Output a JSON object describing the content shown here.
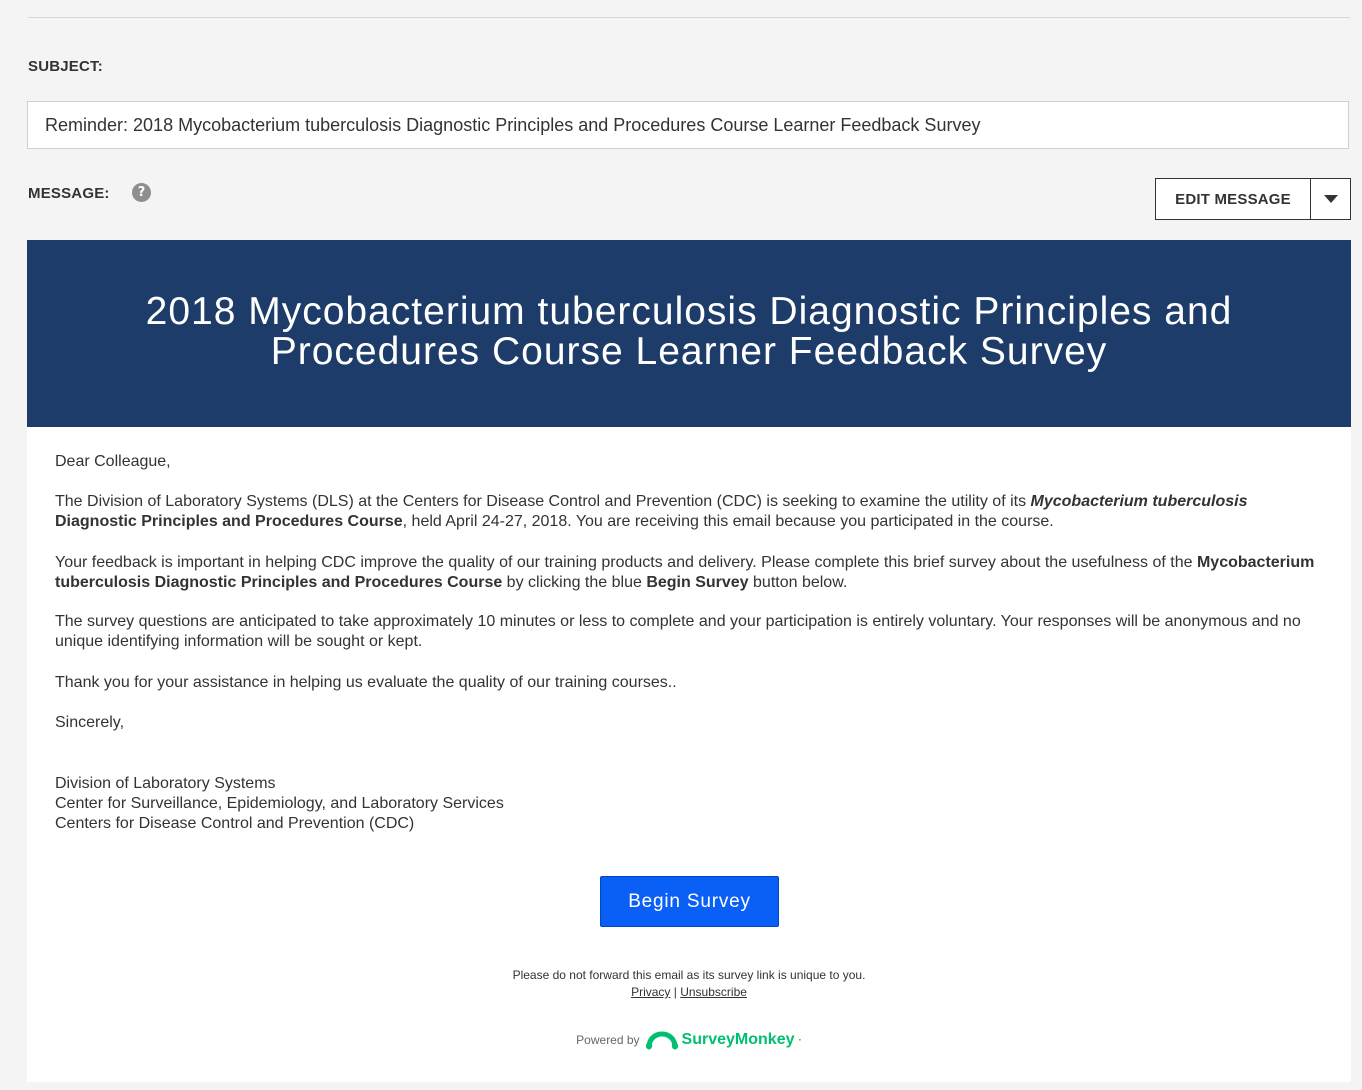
{
  "subject": {
    "label": "SUBJECT:",
    "value": "Reminder: 2018 Mycobacterium tuberculosis Diagnostic Principles and Procedures Course Learner Feedback Survey"
  },
  "message": {
    "label": "MESSAGE:",
    "help_icon": "?",
    "edit_label": "EDIT MESSAGE"
  },
  "email": {
    "banner_title_line1": "2018 Mycobacterium tuberculosis Diagnostic Principles and",
    "banner_title_line2": "Procedures Course Learner Feedback Survey",
    "greeting": "Dear Colleague,",
    "p1": {
      "a": "The Division of Laboratory Systems (DLS) at the Centers for Disease Control and Prevention (CDC) is seeking to examine the utility of its ",
      "b_italic": "Mycobacterium tuberculosis",
      "c_bold": " Diagnostic Principles and Procedures Course",
      "d": ", held April 24-27, 2018.  You are receiving this email because you participated in the course."
    },
    "p2": {
      "a": "Your feedback is important in helping CDC improve the quality of our training products and delivery. Please complete this brief survey about the usefulness of the ",
      "b_bold": "Mycobacterium tuberculosis Diagnostic Principles and Procedures Course",
      "c": " by clicking the blue ",
      "d_bold": "Begin Survey",
      "e": " button below."
    },
    "p3": "The survey questions are anticipated to take approximately 10 minutes or less to complete and your participation is entirely voluntary. Your responses will be anonymous and no unique identifying information will be sought or kept.",
    "p4": "Thank you for your assistance in helping us evaluate the quality of our training courses..",
    "closing": "Sincerely,",
    "signature": [
      "Division of Laboratory Systems",
      "Center for Surveillance, Epidemiology, and Laboratory Services",
      "Centers for Disease Control and Prevention (CDC)"
    ],
    "button_label": "Begin Survey",
    "button_color": "#0a5ff6",
    "banner_color": "#1d3c69",
    "footer_note": "Please do not forward this email as its survey link is unique to you.",
    "privacy_link": "Privacy",
    "separator": "|",
    "unsubscribe_link": "Unsubscribe",
    "powered_by": "Powered by",
    "brand_name": "SurveyMonkey",
    "brand_mark": "·",
    "brand_color": "#00bf6f",
    "brand_icon": "surveymonkey-logo-icon"
  }
}
